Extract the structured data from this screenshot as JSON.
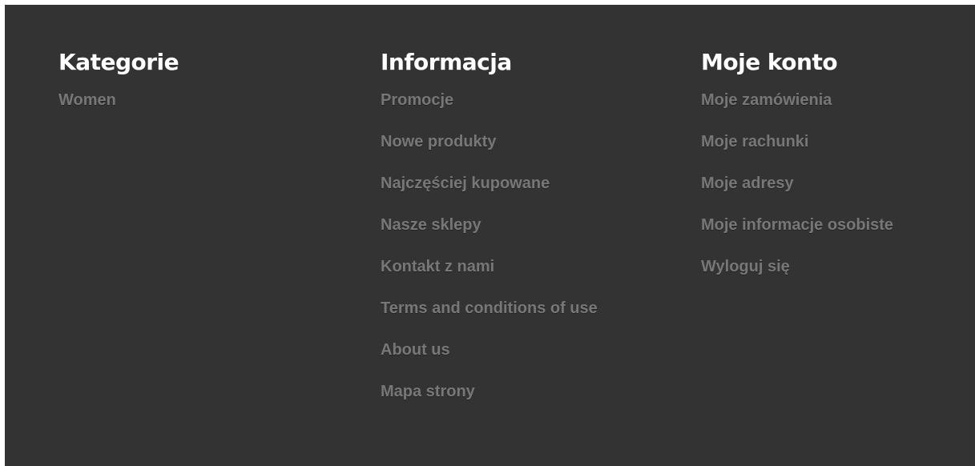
{
  "footer": {
    "categories": {
      "title": "Kategorie",
      "items": [
        "Women"
      ]
    },
    "information": {
      "title": "Informacja",
      "items": [
        "Promocje",
        "Nowe produkty",
        "Najczęściej kupowane",
        "Nasze sklepy",
        "Kontakt z nami",
        "Terms and conditions of use",
        "About us",
        "Mapa strony"
      ]
    },
    "account": {
      "title": "Moje konto",
      "items": [
        "Moje zamówienia",
        "Moje rachunki",
        "Moje adresy",
        "Moje informacje osobiste",
        "Wyloguj się"
      ]
    }
  },
  "colors": {
    "background": "#333333",
    "heading": "#ffffff",
    "link": "#777777"
  }
}
